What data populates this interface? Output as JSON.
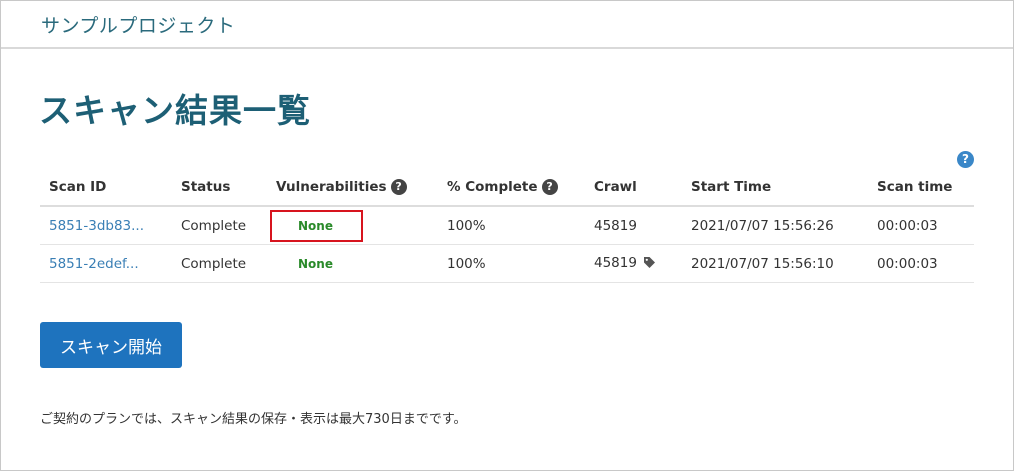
{
  "header": {
    "project_name": "サンプルプロジェクト"
  },
  "page": {
    "title": "スキャン結果一覧",
    "help_icon": "question-circle-icon"
  },
  "table": {
    "columns": [
      "Scan ID",
      "Status",
      "Vulnerabilities",
      "% Complete",
      "Crawl",
      "Start Time",
      "Scan time"
    ],
    "column_help_icons": {
      "Vulnerabilities": "question-circle-icon",
      "% Complete": "question-circle-icon"
    },
    "rows": [
      {
        "scan_id": "5851-3db83...",
        "status": "Complete",
        "vulnerabilities": "None",
        "complete": "100%",
        "crawl": "45819",
        "crawl_tag": false,
        "start_time": "2021/07/07 15:56:26",
        "scan_time": "00:00:03",
        "highlighted": true
      },
      {
        "scan_id": "5851-2edef...",
        "status": "Complete",
        "vulnerabilities": "None",
        "complete": "100%",
        "crawl": "45819",
        "crawl_tag": true,
        "crawl_tag_icon": "tag-icon",
        "start_time": "2021/07/07 15:56:10",
        "scan_time": "00:00:03",
        "highlighted": false
      }
    ]
  },
  "actions": {
    "start_scan_label": "スキャン開始"
  },
  "footer": {
    "retention_note": "ご契約のプランでは、スキャン結果の保存・表示は最大730日までです。"
  },
  "colors": {
    "title": "#1d5f75",
    "link": "#3a7fb5",
    "none_status": "#2a8a2a",
    "highlight_border": "#d7141e",
    "button": "#1e73be"
  }
}
